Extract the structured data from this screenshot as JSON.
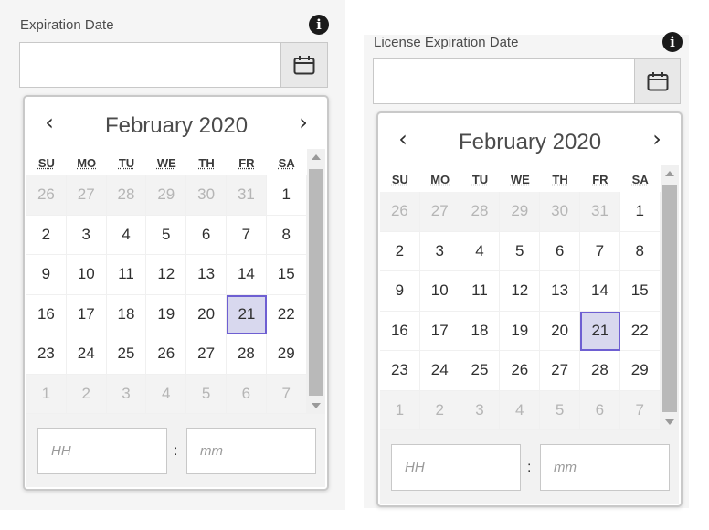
{
  "left": {
    "label": "Expiration Date",
    "info_icon": "i",
    "month": "February 2020",
    "prev": "‹",
    "next": "›",
    "time_hour_placeholder": "HH",
    "time_min_placeholder": "mm",
    "colon": ":"
  },
  "right": {
    "label": "License Expiration Date",
    "info_icon": "i",
    "month": "February 2020",
    "prev": "‹",
    "next": "›",
    "time_hour_placeholder": "HH",
    "time_min_placeholder": "mm",
    "colon": ":"
  },
  "weekdays": [
    "SU",
    "MO",
    "TU",
    "WE",
    "TH",
    "FR",
    "SA"
  ],
  "days": [
    [
      "26",
      "27",
      "28",
      "29",
      "30",
      "31",
      "1"
    ],
    [
      "2",
      "3",
      "4",
      "5",
      "6",
      "7",
      "8"
    ],
    [
      "9",
      "10",
      "11",
      "12",
      "13",
      "14",
      "15"
    ],
    [
      "16",
      "17",
      "18",
      "19",
      "20",
      "21",
      "22"
    ],
    [
      "23",
      "24",
      "25",
      "26",
      "27",
      "28",
      "29"
    ],
    [
      "1",
      "2",
      "3",
      "4",
      "5",
      "6",
      "7"
    ]
  ],
  "out_of_month": [
    [
      true,
      true,
      true,
      true,
      true,
      true,
      false
    ],
    [
      false,
      false,
      false,
      false,
      false,
      false,
      false
    ],
    [
      false,
      false,
      false,
      false,
      false,
      false,
      false
    ],
    [
      false,
      false,
      false,
      false,
      false,
      false,
      false
    ],
    [
      false,
      false,
      false,
      false,
      false,
      false,
      false
    ],
    [
      true,
      true,
      true,
      true,
      true,
      true,
      true
    ]
  ],
  "selected_day": "21",
  "colors": {
    "selected_bg": "#d8d8ee",
    "selected_border": "#6e5fd2"
  }
}
